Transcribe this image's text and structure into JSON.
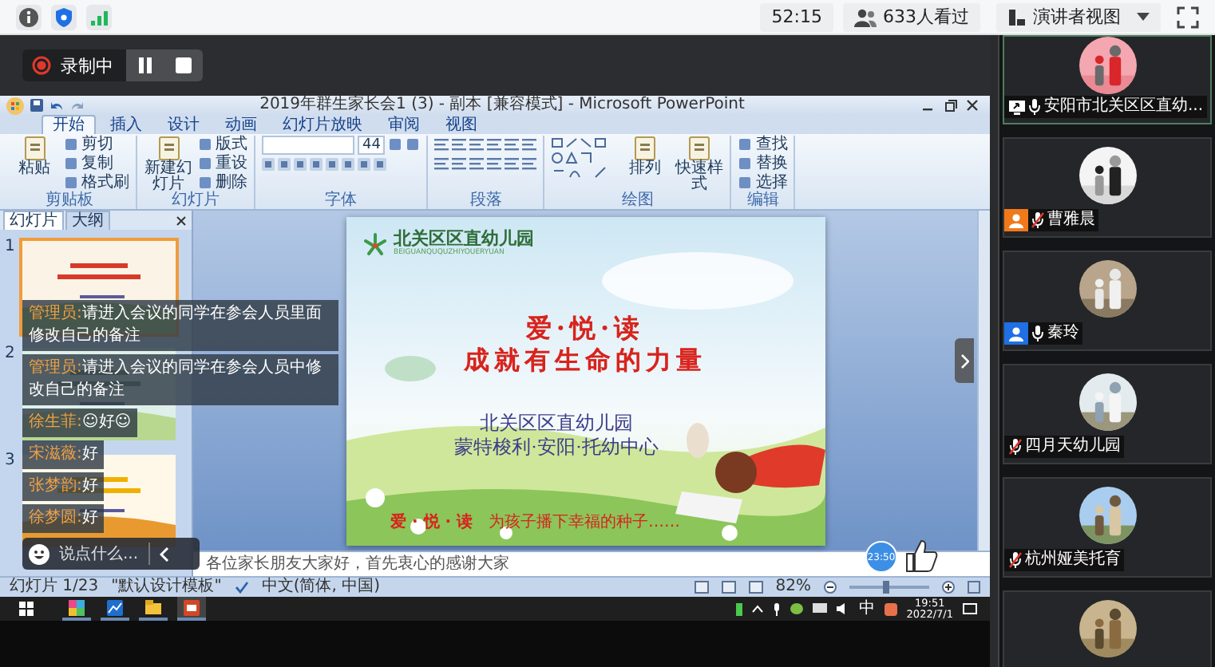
{
  "top_bar": {
    "duration": "52:15",
    "viewers": "633人看过",
    "view_mode": "演讲者视图"
  },
  "recording": {
    "label": "录制中"
  },
  "ppt": {
    "title": "2019年群生家长会1 (3) - 副本 [兼容模式] - Microsoft PowerPoint",
    "tabs": [
      {
        "label": "开始",
        "selected": true
      },
      {
        "label": "插入",
        "selected": false
      },
      {
        "label": "设计",
        "selected": false
      },
      {
        "label": "动画",
        "selected": false
      },
      {
        "label": "幻灯片放映",
        "selected": false
      },
      {
        "label": "审阅",
        "selected": false
      },
      {
        "label": "视图",
        "selected": false
      }
    ],
    "ribbon_groups": [
      {
        "kind": "buttons",
        "label": "剪贴板",
        "large": [
          "粘贴"
        ],
        "small": [
          "剪切",
          "复制",
          "格式刷"
        ]
      },
      {
        "kind": "buttons",
        "label": "幻灯片",
        "large": [
          "新建幻灯片"
        ],
        "small": [
          "版式",
          "重设",
          "删除"
        ]
      },
      {
        "kind": "font",
        "label": "字体",
        "size": "44"
      },
      {
        "kind": "paragraph",
        "label": "段落"
      },
      {
        "kind": "drawing",
        "label": "绘图",
        "large": [
          "排列",
          "快速样式"
        ]
      },
      {
        "kind": "buttons",
        "label": "编辑",
        "small": [
          "查找",
          "替换",
          "选择"
        ]
      }
    ],
    "pane_tabs": [
      {
        "label": "幻灯片",
        "selected": true
      },
      {
        "label": "大纲",
        "selected": false
      }
    ],
    "thumbnails": [
      {
        "number": "1",
        "selected": true
      },
      {
        "number": "2",
        "selected": false
      },
      {
        "number": "3",
        "selected": false
      }
    ],
    "slide": {
      "logo": "北关区区直幼儿园",
      "logo_pinyin": "BEIGUANQUQUZHIYOUERYUAN",
      "title": "爱·悦·读",
      "subtitle": "成就有生命的力量",
      "school": "北关区区直幼儿园",
      "center": "蒙特梭利·安阳·托幼中心",
      "footer_title": "爱 · 悦 · 读",
      "footer_text": "为孩子播下幸福的种子……"
    },
    "notes": "各位家长朋友大家好，首先衷心的感谢大家",
    "status": {
      "slide": "幻灯片 1/23",
      "theme": "\"默认设计模板\"",
      "language": "中文(简体, 中国)",
      "zoom": "82%",
      "zoom_slider": {
        "level": 0.45
      }
    }
  },
  "taskbar": {
    "apps": [
      {
        "kind": "grid",
        "selected": false
      },
      {
        "kind": "chart",
        "selected": false
      },
      {
        "kind": "folder",
        "selected": false
      },
      {
        "kind": "slides",
        "selected": true
      }
    ],
    "ime": "中",
    "time": "19:51",
    "date": "2022/7/1"
  },
  "chat": {
    "messages": [
      {
        "sender": "管理员:",
        "text": "请进入会议的同学在参会人员里面修改自己的备注"
      },
      {
        "sender": "管理员:",
        "text": "请进入会议的同学在参会人员中修改自己的备注"
      },
      {
        "sender": "徐生菲:",
        "text": "☺好☺"
      },
      {
        "sender": "宋滋薇:",
        "text": "好"
      },
      {
        "sender": "张梦韵:",
        "text": "好"
      },
      {
        "sender": "徐梦圆:",
        "text": "好"
      }
    ],
    "placeholder": "说点什么..."
  },
  "timer": "23:50",
  "participants": [
    {
      "kind": "person",
      "name": "安阳市北关区区直幼...",
      "sharing": true,
      "muted": false,
      "speaking": true
    },
    {
      "kind": "person",
      "name": "曹雅晨",
      "color": "#f07a1a",
      "sharing": false,
      "muted": true,
      "speaking": false
    },
    {
      "kind": "person",
      "name": "秦玲",
      "color": "#1f6fe5",
      "sharing": false,
      "muted": false,
      "speaking": false
    },
    {
      "kind": "person",
      "name": "四月天幼儿园",
      "sharing": false,
      "muted": true,
      "speaking": false
    },
    {
      "kind": "person",
      "name": "杭州娅美托育",
      "sharing": false,
      "muted": true,
      "speaking": false
    },
    {
      "kind": "picture"
    }
  ]
}
